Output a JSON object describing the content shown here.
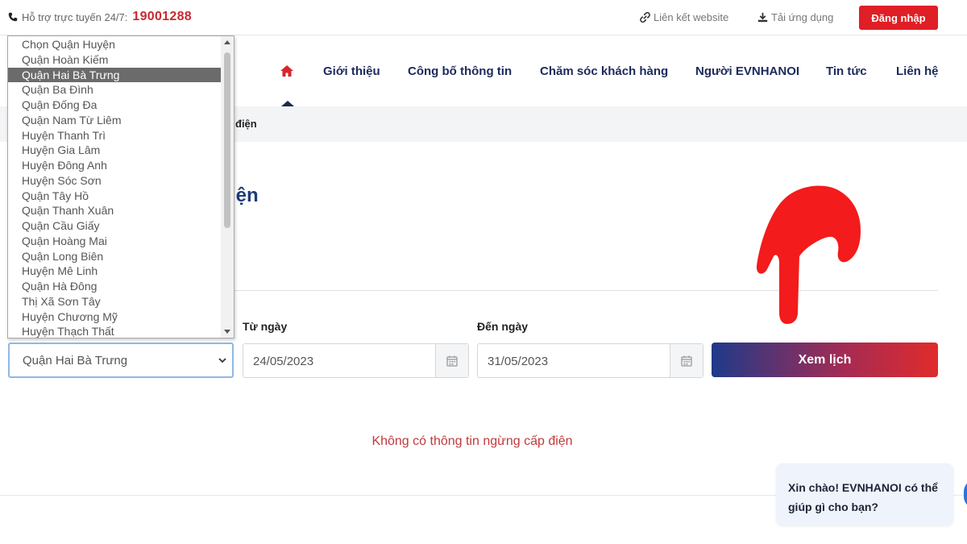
{
  "topbar": {
    "support_label": "Hỗ trợ trực tuyến 24/7:",
    "hotline": "19001288",
    "link_website": "Liên kết website",
    "link_app": "Tải ứng dụng",
    "login_label": "Đăng nhập"
  },
  "nav": {
    "items": [
      "Giới thiệu",
      "Công bố thông tin",
      "Chăm sóc khách hàng",
      "Người EVNHANOI",
      "Tin tức",
      "Liên hệ"
    ]
  },
  "breadcrumb": {
    "text": "điện"
  },
  "page": {
    "title_fragment": "iện"
  },
  "form": {
    "district_selected": "Quận Hai Bà Trưng",
    "from_label": "Từ ngày",
    "from_value": "24/05/2023",
    "to_label": "Đến ngày",
    "to_value": "31/05/2023",
    "submit_label": "Xem lịch"
  },
  "dropdown": {
    "options": [
      "Chọn Quận Huyện",
      "Quận Hoàn Kiếm",
      "Quận Hai Bà Trưng",
      "Quận Ba Đình",
      "Quận Đống Đa",
      "Quận Nam Từ Liêm",
      "Huyện Thanh Trì",
      "Huyện Gia Lâm",
      "Huyện Đông Anh",
      "Huyện Sóc Sơn",
      "Quận Tây Hồ",
      "Quận Thanh Xuân",
      "Quận Cầu Giấy",
      "Quận Hoàng Mai",
      "Quận Long Biên",
      "Huyện Mê Linh",
      "Quận Hà Đông",
      "Thị Xã Sơn Tây",
      "Huyện Chương Mỹ",
      "Huyện Thạch Thất"
    ],
    "selected_index": 2
  },
  "result": {
    "message": "Không có thông tin ngừng cấp điện"
  },
  "chat": {
    "greeting": "Xin chào! EVNHANOI có thể giúp gì cho bạn?"
  },
  "colors": {
    "brand_red": "#e01e25",
    "brand_blue": "#1d2a5c",
    "message_red": "#c0393b"
  }
}
